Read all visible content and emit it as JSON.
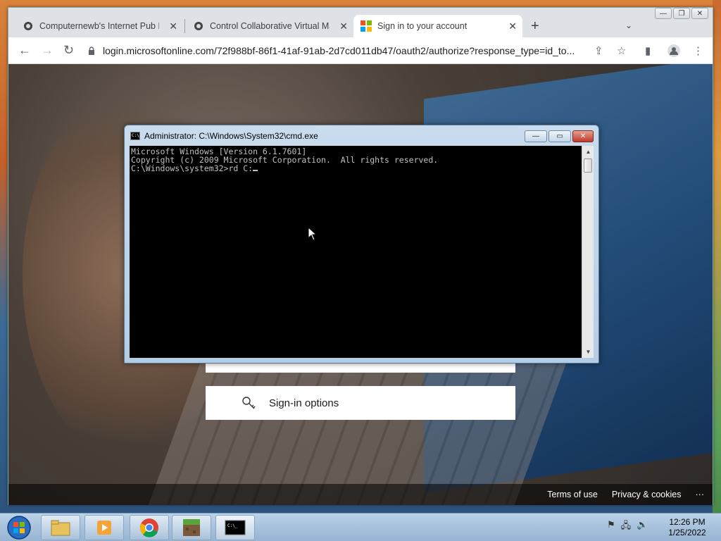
{
  "browser": {
    "tabs": [
      {
        "title": "Computernewb's Internet Pub Hub",
        "close": "✕"
      },
      {
        "title": "Control Collaborative Virtual Machine",
        "close": "✕"
      },
      {
        "title": "Sign in to your account",
        "close": "✕"
      }
    ],
    "new_tab": "+",
    "tab_dropdown": "⌄",
    "url": "login.microsoftonline.com/72f988bf-86f1-41af-91ab-2d7cd011db47/oauth2/authorize?response_type=id_to..."
  },
  "page": {
    "signin_options": "Sign-in options",
    "footer": {
      "terms": "Terms of use",
      "privacy": "Privacy & cookies",
      "more": "···"
    }
  },
  "cmd": {
    "title": "Administrator: C:\\Windows\\System32\\cmd.exe",
    "lines": [
      "Microsoft Windows [Version 6.1.7601]",
      "Copyright (c) 2009 Microsoft Corporation.  All rights reserved.",
      "",
      "C:\\Windows\\system32>rd C:"
    ]
  },
  "taskbar": {
    "time": "12:26 PM",
    "date": "1/25/2022"
  },
  "colors": {
    "accent": "#1a73e8",
    "cmd_bg": "#000000",
    "cmd_text": "#c0c0c0"
  }
}
